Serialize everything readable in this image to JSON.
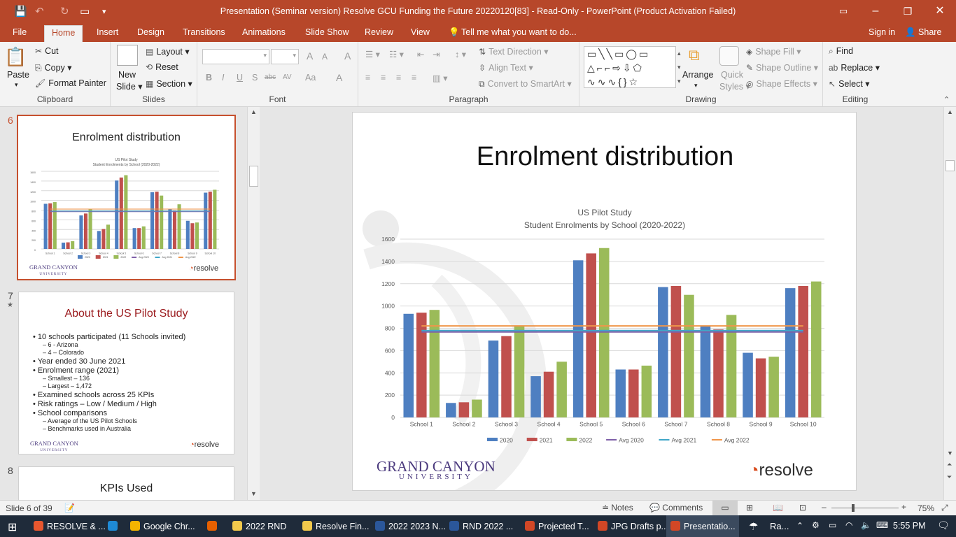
{
  "window": {
    "title": "Presentation (Seminar version) Resolve GCU Funding the Future 20220120[83]  -  Read-Only - PowerPoint (Product Activation Failed)",
    "signin": "Sign in",
    "share": "Share"
  },
  "tabs": [
    "File",
    "Home",
    "Insert",
    "Design",
    "Transitions",
    "Animations",
    "Slide Show",
    "Review",
    "View"
  ],
  "tell_me": "Tell me what you want to do...",
  "ribbon": {
    "clipboard": {
      "paste": "Paste",
      "cut": "Cut",
      "copy": "Copy",
      "format_painter": "Format Painter",
      "label": "Clipboard"
    },
    "slides": {
      "new_slide_1": "New",
      "new_slide_2": "Slide",
      "layout": "Layout",
      "reset": "Reset",
      "section": "Section",
      "label": "Slides"
    },
    "font": {
      "label": "Font",
      "bold": "B",
      "italic": "I",
      "underline": "U",
      "shadow": "S",
      "strike": "abc",
      "spacing": "AV",
      "case": "Aa",
      "color": "A",
      "grow": "A",
      "shrink": "A",
      "clear": "A"
    },
    "paragraph": {
      "label": "Paragraph",
      "text_direction": "Text Direction",
      "align_text": "Align Text",
      "smartart": "Convert to SmartArt"
    },
    "drawing": {
      "label": "Drawing",
      "arrange": "Arrange",
      "quick_styles_1": "Quick",
      "quick_styles_2": "Styles",
      "shape_fill": "Shape Fill",
      "shape_outline": "Shape Outline",
      "shape_effects": "Shape Effects"
    },
    "editing": {
      "label": "Editing",
      "find": "Find",
      "replace": "Replace",
      "select": "Select"
    }
  },
  "thumbnails": {
    "slide6": {
      "num": "6",
      "title": "Enrolment distribution",
      "chart_title": "US Pilot Study",
      "chart_subtitle": "Student Enrolments by School (2020-2022)"
    },
    "slide7": {
      "num": "7",
      "star": "★",
      "title": "About the US Pilot Study",
      "bullets": [
        {
          "text": "10 schools participated (11 Schools invited)",
          "sub": [
            "6 - Arizona",
            "4 – Colorado"
          ]
        },
        {
          "text": "Year ended 30 June 2021",
          "sub": []
        },
        {
          "text": "Enrolment range (2021)",
          "sub": [
            "Smallest – 136",
            "Largest – 1,472"
          ]
        },
        {
          "text": "Examined schools across 25 KPIs",
          "sub": []
        },
        {
          "text": "Risk ratings – Low / Medium / High",
          "sub": []
        },
        {
          "text": "School comparisons",
          "sub": [
            "Average of the US Pilot Schools",
            "Benchmarks used in Australia"
          ]
        }
      ]
    },
    "slide8": {
      "num": "8",
      "title": "KPIs Used"
    }
  },
  "slide": {
    "title": "Enrolment distribution",
    "logo_left_1": "GRAND CANYON",
    "logo_left_2": "UNIVERSITY",
    "logo_left_small_1": "GRAND CANYON",
    "logo_left_small_2": "UNIVERSITY",
    "logo_right": "resolve"
  },
  "chart_data": {
    "type": "bar",
    "title": "US Pilot Study",
    "subtitle": "Student Enrolments by School (2020-2022)",
    "categories": [
      "School 1",
      "School 2",
      "School 3",
      "School 4",
      "School 5",
      "School 6",
      "School 7",
      "School 8",
      "School 9",
      "School 10"
    ],
    "series": [
      {
        "name": "2020",
        "color": "#4e7fc1",
        "values": [
          930,
          130,
          690,
          370,
          1410,
          430,
          1170,
          820,
          580,
          1160
        ]
      },
      {
        "name": "2021",
        "color": "#c0504d",
        "values": [
          940,
          136,
          730,
          410,
          1472,
          430,
          1180,
          790,
          530,
          1180
        ]
      },
      {
        "name": "2022",
        "color": "#9bbb59",
        "values": [
          965,
          160,
          820,
          500,
          1520,
          465,
          1100,
          920,
          545,
          1220
        ]
      }
    ],
    "lines": [
      {
        "name": "Avg 2020",
        "color": "#7f5fa8",
        "value": 767
      },
      {
        "name": "Avg 2021",
        "color": "#3fa6c8",
        "value": 780
      },
      {
        "name": "Avg 2022",
        "color": "#f0964a",
        "value": 821
      }
    ],
    "ylim": [
      0,
      1600
    ],
    "yticks": [
      0,
      200,
      400,
      600,
      800,
      1000,
      1200,
      1400,
      1600
    ],
    "legend_position": "bottom"
  },
  "status": {
    "slide_info": "Slide 6 of 39",
    "notes": "Notes",
    "comments": "Comments",
    "zoom": "75%"
  },
  "taskbar": {
    "items": [
      {
        "label": "RESOLVE & ...",
        "color": "#e8572f"
      },
      {
        "label": "",
        "color": "#1e8ad6"
      },
      {
        "label": "Google Chr...",
        "color": "#f3b400"
      },
      {
        "label": "",
        "color": "#e66000"
      },
      {
        "label": "2022 RND",
        "color": "#f2c94c"
      },
      {
        "label": "Resolve Fin...",
        "color": "#f2c94c"
      },
      {
        "label": "2022 2023 N...",
        "color": "#2b579a"
      },
      {
        "label": "RND 2022 ...",
        "color": "#2b579a"
      },
      {
        "label": "Projected T...",
        "color": "#d24726"
      },
      {
        "label": "JPG Drafts p...",
        "color": "#d24726"
      },
      {
        "label": "Presentatio...",
        "color": "#d24726"
      }
    ],
    "weather": "Ra...",
    "time": "5:55 PM"
  }
}
